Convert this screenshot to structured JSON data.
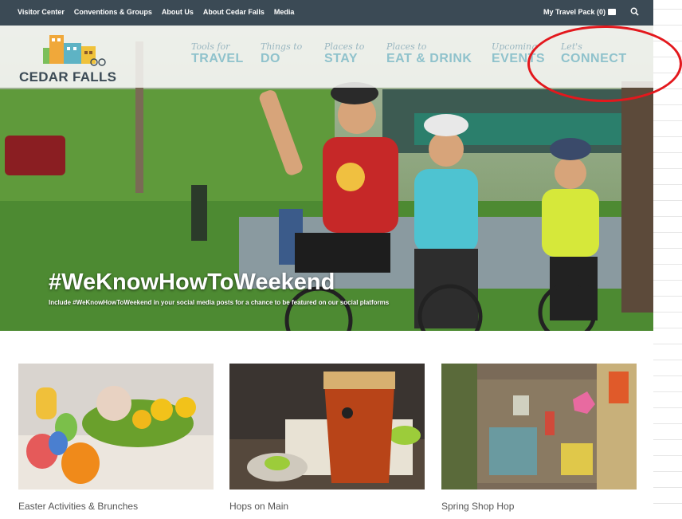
{
  "utility_bar": {
    "links": [
      "Visitor Center",
      "Conventions & Groups",
      "About Us",
      "About Cedar Falls",
      "Media"
    ],
    "travel_pack": "My Travel Pack (0)"
  },
  "logo": {
    "text": "CEDAR FALLS"
  },
  "nav": [
    {
      "small": "Tools for",
      "big": "TRAVEL"
    },
    {
      "small": "Things to",
      "big": "DO"
    },
    {
      "small": "Places to",
      "big": "STAY"
    },
    {
      "small": "Places to",
      "big": "EAT & DRINK"
    },
    {
      "small": "Upcoming",
      "big": "EVENTS"
    },
    {
      "small": "Let's",
      "big": "CONNECT"
    }
  ],
  "hero": {
    "hashtag": "#WeKnowHowToWeekend",
    "subtitle": "Include #WeKnowHowToWeekend in your social media posts for a chance to be featured on our social platforms"
  },
  "cards": [
    {
      "caption": "Easter Activities & Brunches"
    },
    {
      "caption": "Hops on Main"
    },
    {
      "caption": "Spring Shop Hop"
    }
  ],
  "colors": {
    "utility_bar": "#3b4a55",
    "nav_text": "#8fc2cc",
    "annotation": "#e3181d"
  }
}
